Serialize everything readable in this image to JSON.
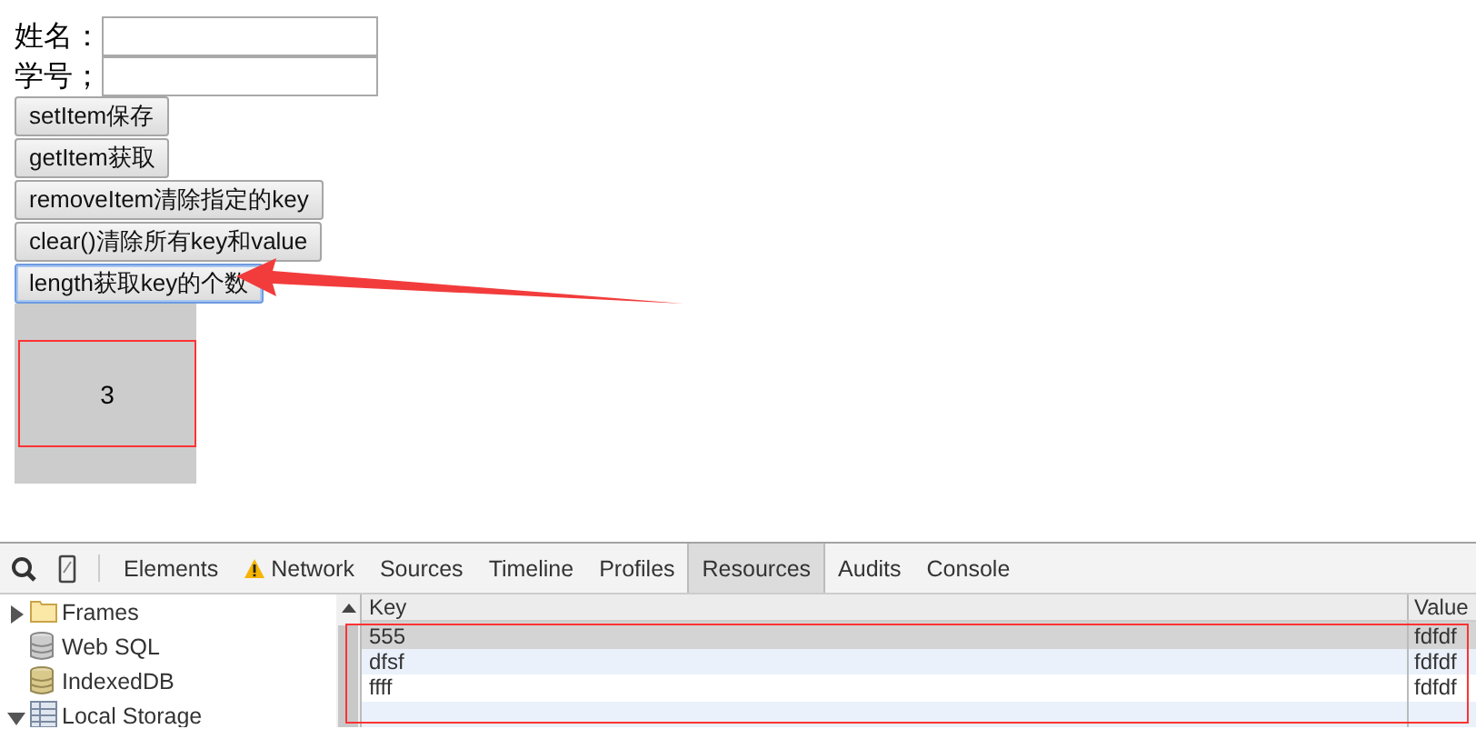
{
  "form": {
    "fields": [
      {
        "label": "姓名："
      },
      {
        "label": "学号；"
      }
    ],
    "buttons": [
      {
        "label": "setItem保存",
        "focused": false
      },
      {
        "label": "getItem获取",
        "focused": false
      },
      {
        "label": "removeItem清除指定的key",
        "focused": false
      },
      {
        "label": "clear()清除所有key和value",
        "focused": false
      },
      {
        "label": "length获取key的个数",
        "focused": true
      }
    ],
    "result": "3"
  },
  "devtools": {
    "tabs": [
      {
        "label": "Elements",
        "selected": false,
        "warning": false
      },
      {
        "label": "Network",
        "selected": false,
        "warning": true
      },
      {
        "label": "Sources",
        "selected": false,
        "warning": false
      },
      {
        "label": "Timeline",
        "selected": false,
        "warning": false
      },
      {
        "label": "Profiles",
        "selected": false,
        "warning": false
      },
      {
        "label": "Resources",
        "selected": true,
        "warning": false
      },
      {
        "label": "Audits",
        "selected": false,
        "warning": false
      },
      {
        "label": "Console",
        "selected": false,
        "warning": false
      }
    ],
    "sidebar": {
      "items": [
        {
          "label": "Frames",
          "kind": "folder",
          "expanded": false
        },
        {
          "label": "Web SQL",
          "kind": "database"
        },
        {
          "label": "IndexedDB",
          "kind": "indexeddb"
        },
        {
          "label": "Local Storage",
          "kind": "storage",
          "expanded": true
        }
      ]
    },
    "table": {
      "columns": [
        "Key",
        "Value"
      ],
      "rows": [
        {
          "key": "555",
          "value": "fdfdf",
          "selected": true
        },
        {
          "key": "dfsf",
          "value": "fdfdf",
          "selected": false
        },
        {
          "key": "ffff",
          "value": "fdfdf",
          "selected": false
        }
      ]
    }
  }
}
